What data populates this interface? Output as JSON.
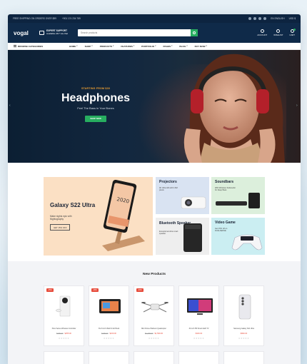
{
  "topbar": {
    "promo": "FREE SHIPPING ON ORDERS OVER $99",
    "phone": "+901 174 234 789",
    "language": "EN ENGLISH",
    "currency": "USD $"
  },
  "header": {
    "logo": "vogal",
    "support_title": "EXPERT SUPPORT",
    "support_sub": "Available 24/7 via chat",
    "search_placeholder": "Search products",
    "account_label": "ACCOUNT",
    "wishlist_label": "WISHLIST",
    "cart_label": "CART"
  },
  "nav": {
    "categories_label": "BROWSE CATEGORIES",
    "items": [
      "HOME",
      "SHOP",
      "PRODUCTS",
      "FEATURES",
      "PORTFOLIO",
      "PAGES",
      "BLOG",
      "BUY NOW"
    ]
  },
  "hero": {
    "kicker": "STARTING FROM $30",
    "title": "Headphones",
    "subtitle": "Feel The Bass in Your Bones",
    "cta": "SHOP NOW"
  },
  "banners": {
    "galaxy_title": "Galaxy S22 Ultra",
    "galaxy_text": "Make nights epic with Nightography",
    "galaxy_cta": "GET 15% OFF",
    "phone_time": "2020",
    "tiles": [
      {
        "title": "Projectors",
        "text": "4K Ultra HD with 4.6M pixels"
      },
      {
        "title": "Soundbars",
        "text": "With Wireless Subwoofer for Deep Bass"
      },
      {
        "title": "Bluetooth Speaker",
        "text": "Exceptional ultra smart speaker"
      },
      {
        "title": "Video Game",
        "text": "Get 15% off on DUALSENSE"
      }
    ]
  },
  "new_products": {
    "heading": "New Products",
    "items": [
      {
        "sale": "-15%",
        "name": "Xbox Series Wireless Controller",
        "old_price": "$299.00",
        "price": "$255.00"
      },
      {
        "sale": "-18%",
        "name": "XG-5 inch iPad Kit Art Book",
        "old_price": "$199.00",
        "price": "$169.00"
      },
      {
        "sale": "-20%",
        "name": "Mini Drone Platinum Quadcopter",
        "old_price": "$1,799.00",
        "price": "$1,599.00"
      },
      {
        "sale": "",
        "name": "32 inch HD Smart LED TV",
        "old_price": "",
        "price": "$349.00"
      },
      {
        "sale": "",
        "name": "Samsung Galaxy S21 Ultra",
        "old_price": "",
        "price": "$999.00"
      }
    ],
    "stars": "★★★★★"
  },
  "colors": {
    "navy": "#0f2a49",
    "accent_green": "#27ae60",
    "sale_red": "#e74c3c",
    "hero_orange": "#f0a030"
  }
}
